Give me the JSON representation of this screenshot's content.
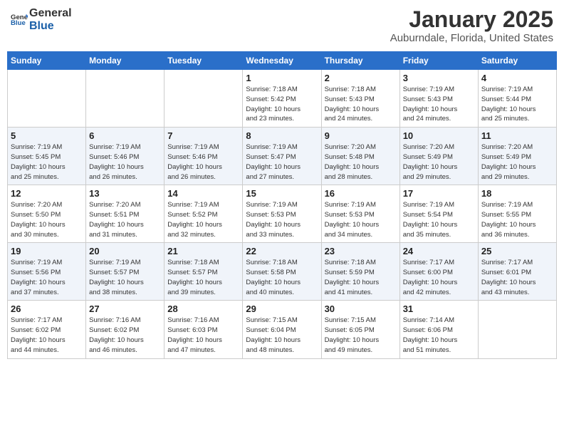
{
  "header": {
    "logo_general": "General",
    "logo_blue": "Blue",
    "title": "January 2025",
    "subtitle": "Auburndale, Florida, United States"
  },
  "days_of_week": [
    "Sunday",
    "Monday",
    "Tuesday",
    "Wednesday",
    "Thursday",
    "Friday",
    "Saturday"
  ],
  "weeks": [
    [
      {
        "day": "",
        "info": ""
      },
      {
        "day": "",
        "info": ""
      },
      {
        "day": "",
        "info": ""
      },
      {
        "day": "1",
        "info": "Sunrise: 7:18 AM\nSunset: 5:42 PM\nDaylight: 10 hours\nand 23 minutes."
      },
      {
        "day": "2",
        "info": "Sunrise: 7:18 AM\nSunset: 5:43 PM\nDaylight: 10 hours\nand 24 minutes."
      },
      {
        "day": "3",
        "info": "Sunrise: 7:19 AM\nSunset: 5:43 PM\nDaylight: 10 hours\nand 24 minutes."
      },
      {
        "day": "4",
        "info": "Sunrise: 7:19 AM\nSunset: 5:44 PM\nDaylight: 10 hours\nand 25 minutes."
      }
    ],
    [
      {
        "day": "5",
        "info": "Sunrise: 7:19 AM\nSunset: 5:45 PM\nDaylight: 10 hours\nand 25 minutes."
      },
      {
        "day": "6",
        "info": "Sunrise: 7:19 AM\nSunset: 5:46 PM\nDaylight: 10 hours\nand 26 minutes."
      },
      {
        "day": "7",
        "info": "Sunrise: 7:19 AM\nSunset: 5:46 PM\nDaylight: 10 hours\nand 26 minutes."
      },
      {
        "day": "8",
        "info": "Sunrise: 7:19 AM\nSunset: 5:47 PM\nDaylight: 10 hours\nand 27 minutes."
      },
      {
        "day": "9",
        "info": "Sunrise: 7:20 AM\nSunset: 5:48 PM\nDaylight: 10 hours\nand 28 minutes."
      },
      {
        "day": "10",
        "info": "Sunrise: 7:20 AM\nSunset: 5:49 PM\nDaylight: 10 hours\nand 29 minutes."
      },
      {
        "day": "11",
        "info": "Sunrise: 7:20 AM\nSunset: 5:49 PM\nDaylight: 10 hours\nand 29 minutes."
      }
    ],
    [
      {
        "day": "12",
        "info": "Sunrise: 7:20 AM\nSunset: 5:50 PM\nDaylight: 10 hours\nand 30 minutes."
      },
      {
        "day": "13",
        "info": "Sunrise: 7:20 AM\nSunset: 5:51 PM\nDaylight: 10 hours\nand 31 minutes."
      },
      {
        "day": "14",
        "info": "Sunrise: 7:19 AM\nSunset: 5:52 PM\nDaylight: 10 hours\nand 32 minutes."
      },
      {
        "day": "15",
        "info": "Sunrise: 7:19 AM\nSunset: 5:53 PM\nDaylight: 10 hours\nand 33 minutes."
      },
      {
        "day": "16",
        "info": "Sunrise: 7:19 AM\nSunset: 5:53 PM\nDaylight: 10 hours\nand 34 minutes."
      },
      {
        "day": "17",
        "info": "Sunrise: 7:19 AM\nSunset: 5:54 PM\nDaylight: 10 hours\nand 35 minutes."
      },
      {
        "day": "18",
        "info": "Sunrise: 7:19 AM\nSunset: 5:55 PM\nDaylight: 10 hours\nand 36 minutes."
      }
    ],
    [
      {
        "day": "19",
        "info": "Sunrise: 7:19 AM\nSunset: 5:56 PM\nDaylight: 10 hours\nand 37 minutes."
      },
      {
        "day": "20",
        "info": "Sunrise: 7:19 AM\nSunset: 5:57 PM\nDaylight: 10 hours\nand 38 minutes."
      },
      {
        "day": "21",
        "info": "Sunrise: 7:18 AM\nSunset: 5:57 PM\nDaylight: 10 hours\nand 39 minutes."
      },
      {
        "day": "22",
        "info": "Sunrise: 7:18 AM\nSunset: 5:58 PM\nDaylight: 10 hours\nand 40 minutes."
      },
      {
        "day": "23",
        "info": "Sunrise: 7:18 AM\nSunset: 5:59 PM\nDaylight: 10 hours\nand 41 minutes."
      },
      {
        "day": "24",
        "info": "Sunrise: 7:17 AM\nSunset: 6:00 PM\nDaylight: 10 hours\nand 42 minutes."
      },
      {
        "day": "25",
        "info": "Sunrise: 7:17 AM\nSunset: 6:01 PM\nDaylight: 10 hours\nand 43 minutes."
      }
    ],
    [
      {
        "day": "26",
        "info": "Sunrise: 7:17 AM\nSunset: 6:02 PM\nDaylight: 10 hours\nand 44 minutes."
      },
      {
        "day": "27",
        "info": "Sunrise: 7:16 AM\nSunset: 6:02 PM\nDaylight: 10 hours\nand 46 minutes."
      },
      {
        "day": "28",
        "info": "Sunrise: 7:16 AM\nSunset: 6:03 PM\nDaylight: 10 hours\nand 47 minutes."
      },
      {
        "day": "29",
        "info": "Sunrise: 7:15 AM\nSunset: 6:04 PM\nDaylight: 10 hours\nand 48 minutes."
      },
      {
        "day": "30",
        "info": "Sunrise: 7:15 AM\nSunset: 6:05 PM\nDaylight: 10 hours\nand 49 minutes."
      },
      {
        "day": "31",
        "info": "Sunrise: 7:14 AM\nSunset: 6:06 PM\nDaylight: 10 hours\nand 51 minutes."
      },
      {
        "day": "",
        "info": ""
      }
    ]
  ]
}
